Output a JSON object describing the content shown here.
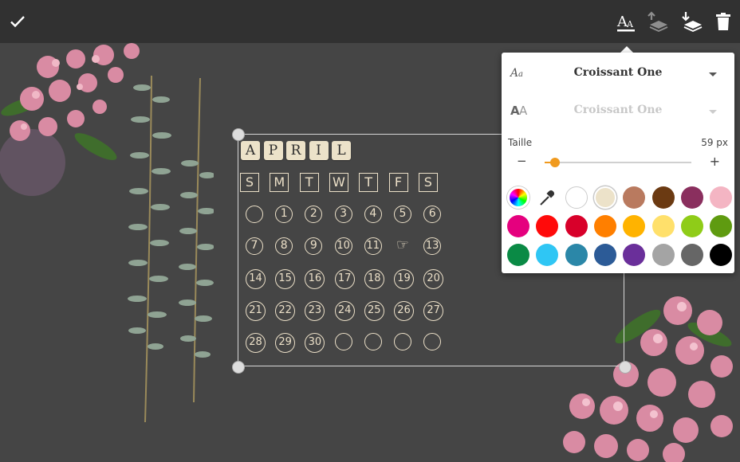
{
  "toolbar": {
    "confirm_icon": "check-icon",
    "text_style_icon": "text-style-icon",
    "layer_up_icon": "layer-up-icon",
    "layer_down_icon": "layer-down-icon",
    "delete_icon": "trash-icon"
  },
  "calendar": {
    "month_letters": [
      "A",
      "P",
      "R",
      "I",
      "L"
    ],
    "weekdays": [
      "S",
      "M",
      "T",
      "W",
      "T",
      "F",
      "S"
    ],
    "weeks": [
      [
        "",
        "1",
        "2",
        "3",
        "4",
        "5",
        "6"
      ],
      [
        "7",
        "8",
        "9",
        "10",
        "11",
        "☞",
        "13"
      ],
      [
        "14",
        "15",
        "16",
        "17",
        "18",
        "19",
        "20"
      ],
      [
        "21",
        "22",
        "23",
        "24",
        "25",
        "26",
        "27"
      ],
      [
        "28",
        "29",
        "30",
        "",
        "",
        "",
        ""
      ]
    ]
  },
  "text_panel": {
    "font_label_icon": "font-family-icon",
    "font_name": "Croissant One",
    "case_icon": "font-case-icon",
    "secondary_font_name": "Croissant One",
    "size_label": "Taille",
    "size_value": "59 px",
    "minus": "−",
    "plus": "+",
    "slider_fraction": 0.07,
    "swatches": [
      "rainbow",
      "eyedropper",
      "#ffffff",
      "#ece2c9",
      "#b97a5f",
      "#6b3a12",
      "#8a2f5e",
      "#f4b5c3",
      "#e5007e",
      "#ff0a0a",
      "#d8002a",
      "#ff7f00",
      "#ffb300",
      "#ffe06b",
      "#8fcc18",
      "#5f9b10",
      "#0a8a45",
      "#2fc6f4",
      "#2b87a8",
      "#2c5b97",
      "#6a2f9a",
      "#a4a4a4",
      "#666666",
      "#000000"
    ],
    "selected_swatch": 3
  }
}
